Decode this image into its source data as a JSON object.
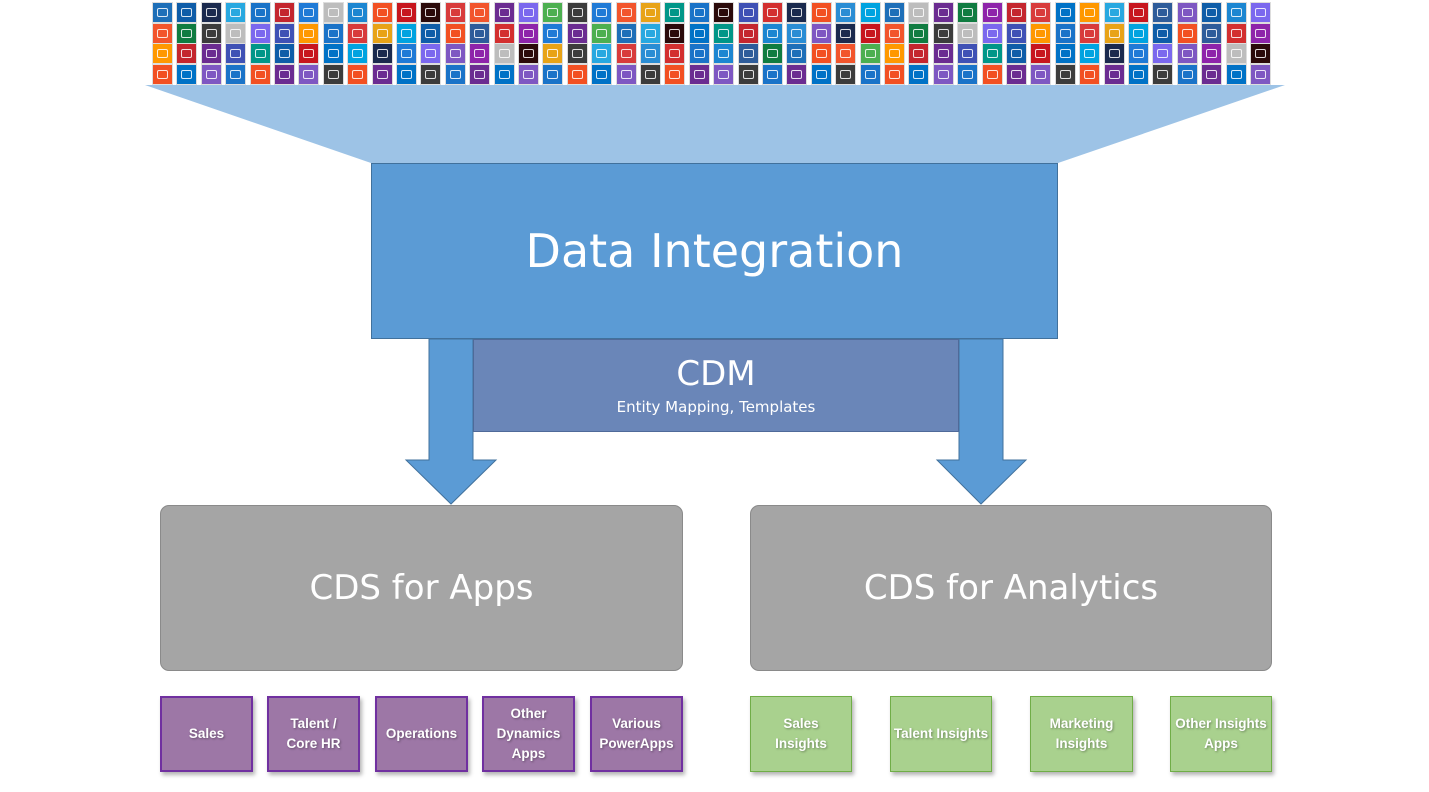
{
  "top": {
    "title": "Data Integration",
    "cdm_title": "CDM",
    "cdm_subtitle": "Entity Mapping, Templates"
  },
  "connectors": {
    "rows": 4,
    "columns": 46,
    "palette": [
      "#1E6FB8",
      "#0F5DA8",
      "#1B2A4E",
      "#28A8E0",
      "#1A73C8",
      "#C4262E",
      "#1F7AD6",
      "#BDBDBD",
      "#1C86D1",
      "#F25022",
      "#C7161E",
      "#2B0A0A",
      "#D83B3B",
      "#F2552C",
      "#6B2C91",
      "#7B68EE",
      "#2A8DD4",
      "#2E5C9A",
      "#3F51B5",
      "#0072C6",
      "#E8A317",
      "#107C41",
      "#4CAF50",
      "#00A3E0",
      "#7E57C2",
      "#D32F2F",
      "#FF9800",
      "#009688",
      "#8E24AA",
      "#3C3C3C"
    ],
    "colors_top_left": [
      "#1E6FB8",
      "#0F5DA8",
      "#1B2A4E",
      "#28A8E0",
      "#1A73C8",
      "#C4262E",
      "#1F7AD6",
      "#BDBDBD",
      "#1C86D1",
      "#F25022",
      "#C7161E",
      "#2B0A0A",
      "#D83B3B",
      "#F2552C",
      "#6B2C91",
      "#7B68EE"
    ]
  },
  "cds": {
    "apps_label": "CDS for Apps",
    "analytics_label": "CDS for Analytics"
  },
  "apps": [
    "Sales",
    "Talent /\nCore HR",
    "Operations",
    "Other\nDynamics\nApps",
    "Various\nPowerApps"
  ],
  "insights": [
    "Sales\nInsights",
    "Talent Insights",
    "Marketing\nInsights",
    "Other Insights\nApps"
  ],
  "colors": {
    "funnel": "#9DC3E6",
    "data_integration": "#5B9BD5",
    "cdm": "#6A86B8",
    "cds": "#A5A5A5",
    "apps": "#9D77A6",
    "insights": "#A9D18E"
  }
}
